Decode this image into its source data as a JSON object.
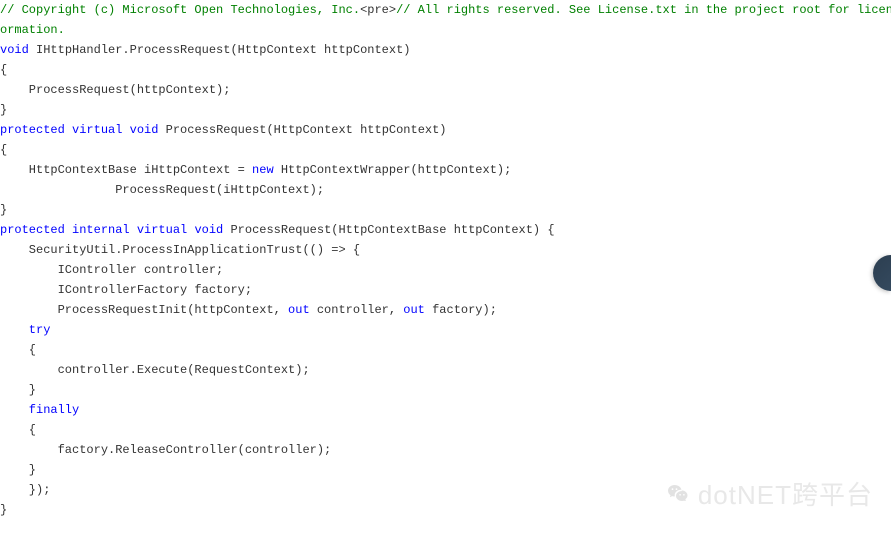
{
  "code": {
    "lines": [
      {
        "segments": [
          {
            "cls": "cmt",
            "text": "// Copyright (c) Microsoft Open Technologies, Inc."
          },
          {
            "cls": "txt",
            "text": "<pre>"
          },
          {
            "cls": "cmt",
            "text": "// All rights reserved. See License.txt in the project root for license "
          }
        ]
      },
      {
        "segments": [
          {
            "cls": "cmt",
            "text": "ormation."
          }
        ]
      },
      {
        "segments": [
          {
            "cls": "kw",
            "text": "void"
          },
          {
            "cls": "txt",
            "text": " IHttpHandler.ProcessRequest(HttpContext httpContext)"
          }
        ]
      },
      {
        "segments": [
          {
            "cls": "txt",
            "text": "{"
          }
        ]
      },
      {
        "segments": [
          {
            "cls": "txt",
            "text": "    ProcessRequest(httpContext);"
          }
        ]
      },
      {
        "segments": [
          {
            "cls": "txt",
            "text": "}"
          }
        ]
      },
      {
        "segments": [
          {
            "cls": "mod",
            "text": "protected"
          },
          {
            "cls": "txt",
            "text": " "
          },
          {
            "cls": "mod",
            "text": "virtual"
          },
          {
            "cls": "txt",
            "text": " "
          },
          {
            "cls": "kw",
            "text": "void"
          },
          {
            "cls": "txt",
            "text": " ProcessRequest(HttpContext httpContext)"
          }
        ]
      },
      {
        "segments": [
          {
            "cls": "txt",
            "text": "{"
          }
        ]
      },
      {
        "segments": [
          {
            "cls": "txt",
            "text": "    HttpContextBase iHttpContext = "
          },
          {
            "cls": "kw",
            "text": "new"
          },
          {
            "cls": "txt",
            "text": " HttpContextWrapper(httpContext);"
          }
        ]
      },
      {
        "segments": [
          {
            "cls": "txt",
            "text": "                ProcessRequest(iHttpContext);"
          }
        ]
      },
      {
        "segments": [
          {
            "cls": "txt",
            "text": "}"
          }
        ]
      },
      {
        "segments": [
          {
            "cls": "mod",
            "text": "protected"
          },
          {
            "cls": "txt",
            "text": " "
          },
          {
            "cls": "mod",
            "text": "internal"
          },
          {
            "cls": "txt",
            "text": " "
          },
          {
            "cls": "mod",
            "text": "virtual"
          },
          {
            "cls": "txt",
            "text": " "
          },
          {
            "cls": "kw",
            "text": "void"
          },
          {
            "cls": "txt",
            "text": " ProcessRequest(HttpContextBase httpContext) {"
          }
        ]
      },
      {
        "segments": [
          {
            "cls": "txt",
            "text": "    SecurityUtil.ProcessInApplicationTrust(() => {"
          }
        ]
      },
      {
        "segments": [
          {
            "cls": "txt",
            "text": "        IController controller;"
          }
        ]
      },
      {
        "segments": [
          {
            "cls": "txt",
            "text": "        IControllerFactory factory;"
          }
        ]
      },
      {
        "segments": [
          {
            "cls": "txt",
            "text": "        ProcessRequestInit(httpContext, "
          },
          {
            "cls": "kw",
            "text": "out"
          },
          {
            "cls": "txt",
            "text": " controller, "
          },
          {
            "cls": "kw",
            "text": "out"
          },
          {
            "cls": "txt",
            "text": " factory);"
          }
        ]
      },
      {
        "segments": [
          {
            "cls": "kw",
            "text": "    try"
          }
        ]
      },
      {
        "segments": [
          {
            "cls": "txt",
            "text": "    {"
          }
        ]
      },
      {
        "segments": [
          {
            "cls": "txt",
            "text": "        controller.Execute(RequestContext);"
          }
        ]
      },
      {
        "segments": [
          {
            "cls": "txt",
            "text": "    }"
          }
        ]
      },
      {
        "segments": [
          {
            "cls": "kw",
            "text": "    finally"
          }
        ]
      },
      {
        "segments": [
          {
            "cls": "txt",
            "text": "    {"
          }
        ]
      },
      {
        "segments": [
          {
            "cls": "txt",
            "text": "        factory.ReleaseController(controller);"
          }
        ]
      },
      {
        "segments": [
          {
            "cls": "txt",
            "text": "    }"
          }
        ]
      },
      {
        "segments": [
          {
            "cls": "txt",
            "text": "    });"
          }
        ]
      },
      {
        "segments": [
          {
            "cls": "txt",
            "text": "}"
          }
        ]
      }
    ]
  },
  "watermark": {
    "text": "dotNET跨平台"
  }
}
